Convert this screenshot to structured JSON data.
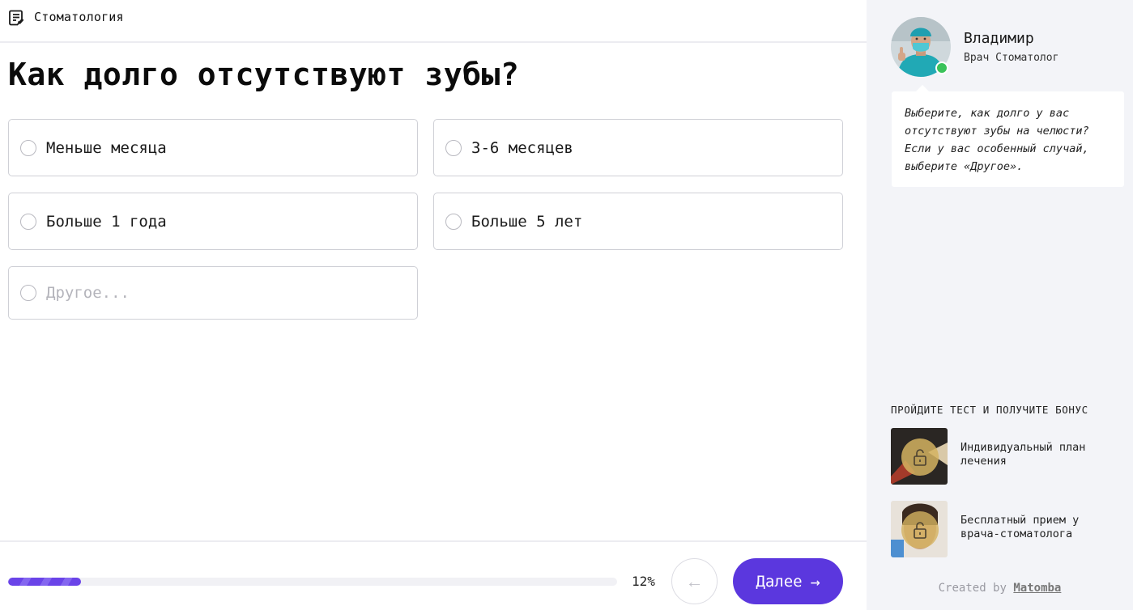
{
  "header": {
    "quiz_title": "Стоматология",
    "icon": "document-list-icon"
  },
  "question": {
    "title": "Как долго отсутствуют зубы?"
  },
  "options": [
    {
      "label": "Меньше месяца",
      "selected": false
    },
    {
      "label": "3-6 месяцев",
      "selected": false
    },
    {
      "label": "Больше 1 года",
      "selected": false
    },
    {
      "label": "Больше 5 лет",
      "selected": false
    }
  ],
  "other_option": {
    "placeholder": "Другое...",
    "value": ""
  },
  "footer": {
    "progress_value": 12,
    "progress_text": "12%",
    "back_icon": "arrow-left-icon",
    "back_symbol": "←",
    "next_label": "Далее",
    "next_symbol": "→"
  },
  "consultant": {
    "name": "Владимир",
    "role": "Врач Стоматолог",
    "status": "online",
    "message": "Выберите, как долго у вас отсутствуют зубы на челюсти? Если у вас особенный случай, выберите «Другое»."
  },
  "bonus": {
    "heading": "ПРОЙДИТЕ ТЕСТ И ПОЛУЧИТЕ БОНУС",
    "items": [
      {
        "label": "Индивидуальный план лечения",
        "icon": "lock-icon"
      },
      {
        "label": "Бесплатный прием у врача-стоматолога",
        "icon": "lock-icon"
      }
    ]
  },
  "credits": {
    "prefix": "Created by",
    "brand": "Matomba"
  },
  "colors": {
    "accent": "#5b37de",
    "progress": "#6a44e8",
    "online": "#3ac25a",
    "sidebar_bg": "#f3f4f8"
  }
}
